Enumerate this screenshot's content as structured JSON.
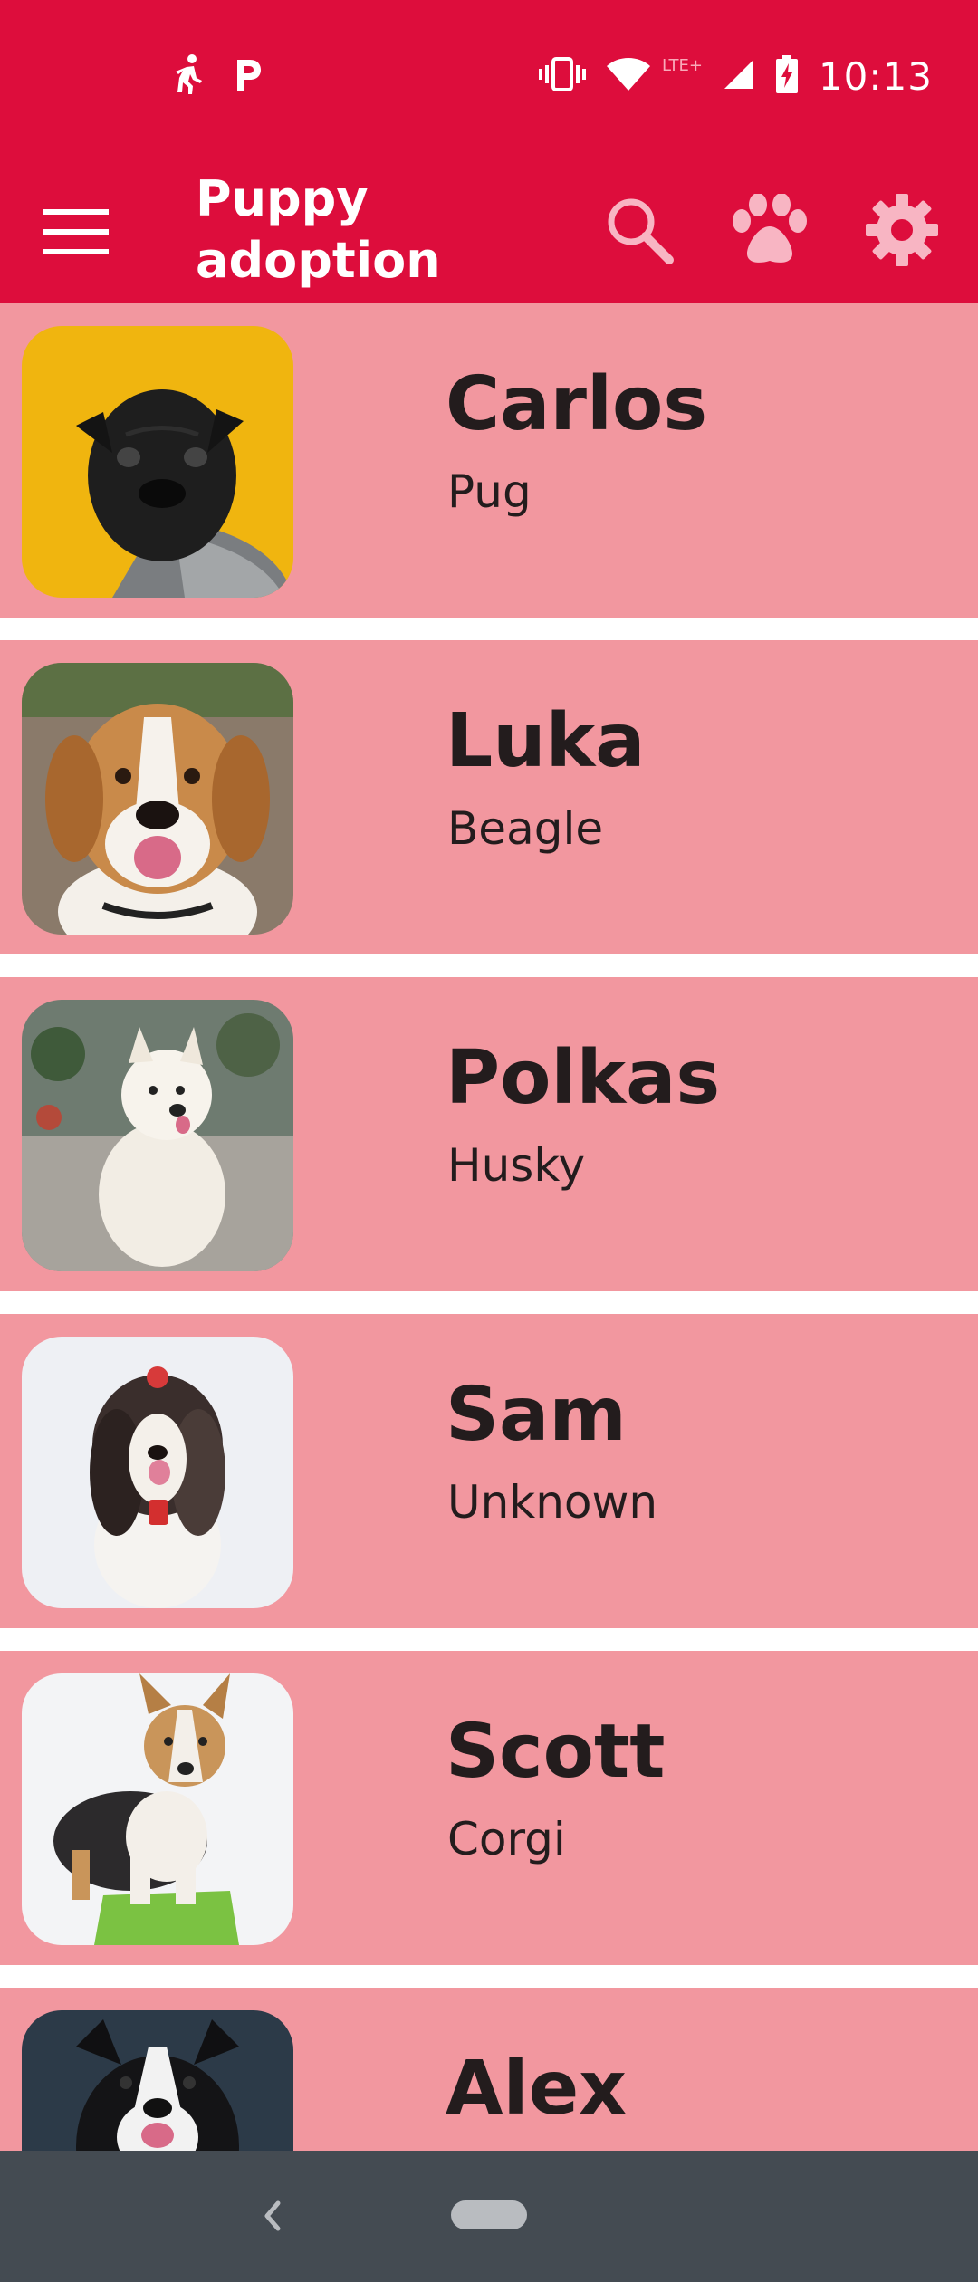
{
  "status_bar": {
    "time": "10:13",
    "network_label": "LTE+",
    "left_icons": [
      "walking-icon",
      "parking-app-icon"
    ],
    "right_icons": [
      "vibrate-icon",
      "wifi-icon",
      "signal-icon",
      "battery-charging-icon"
    ]
  },
  "app_bar": {
    "title": "Puppy adoption",
    "actions": [
      "menu-icon",
      "search-icon",
      "paw-icon",
      "gear-icon"
    ]
  },
  "dogs": [
    {
      "name": "Carlos",
      "breed": "Pug",
      "photo_bg": "#f0b50f"
    },
    {
      "name": "Luka",
      "breed": "Beagle",
      "photo_bg": "#8a7a6a"
    },
    {
      "name": "Polkas",
      "breed": "Husky",
      "photo_bg": "#6e7b70"
    },
    {
      "name": "Sam",
      "breed": "Unknown",
      "photo_bg": "#eef0f4"
    },
    {
      "name": "Scott",
      "breed": "Corgi",
      "photo_bg": "#f3f4f6"
    },
    {
      "name": "Alex",
      "breed": "",
      "photo_bg": "#2c3a48"
    }
  ],
  "colors": {
    "primary": "#dd0d3c",
    "card_background": "#f2979f",
    "text": "#231c1d",
    "nav_bar": "#444b52",
    "paw_icon": "#f8b5c3"
  },
  "nav_bar": {
    "icons": [
      "back-icon",
      "home-pill-icon"
    ]
  }
}
